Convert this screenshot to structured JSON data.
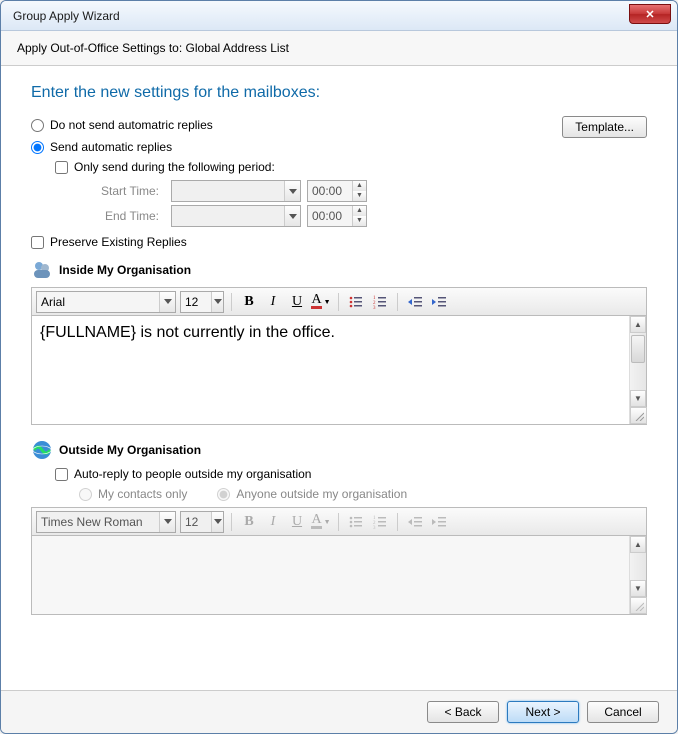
{
  "window": {
    "title": "Group Apply Wizard"
  },
  "subtitle": "Apply Out-of-Office Settings to: Global Address List",
  "heading": "Enter the new settings for the mailboxes:",
  "replies": {
    "doNotSend": "Do not send automatric replies",
    "sendAuto": "Send automatic replies",
    "selected": "sendAuto",
    "onlySendPeriod": "Only send during the following period:",
    "onlySendChecked": false,
    "startLabel": "Start Time:",
    "endLabel": "End Time:",
    "startDate": "",
    "startTime": "00:00",
    "endDate": "",
    "endTime": "00:00"
  },
  "templateBtn": "Template...",
  "preserve": {
    "label": "Preserve Existing Replies",
    "checked": false
  },
  "inside": {
    "title": "Inside My Organisation",
    "font": "Arial",
    "size": "12",
    "body": "{FULLNAME} is not currently in the office."
  },
  "outside": {
    "title": "Outside My Organisation",
    "autoReply": {
      "label": "Auto-reply to people outside my organisation",
      "checked": false
    },
    "contactsOnly": "My contacts only",
    "anyone": "Anyone outside my organisation",
    "font": "Times New Roman",
    "size": "12",
    "body": ""
  },
  "footer": {
    "back": "< Back",
    "next": "Next >",
    "cancel": "Cancel"
  }
}
